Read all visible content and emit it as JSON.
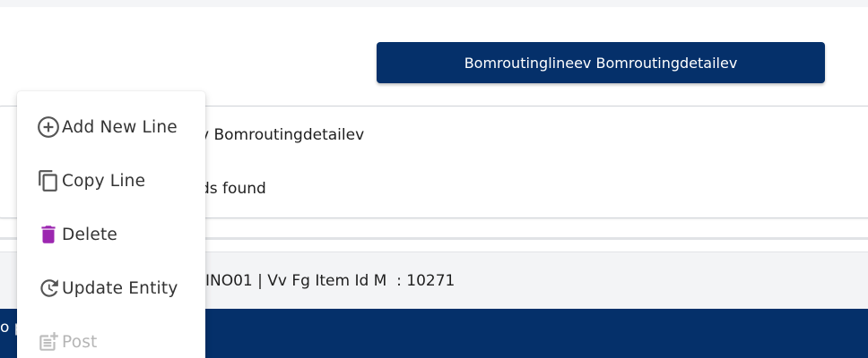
{
  "header": {
    "primary_button_label": "Bomroutinglineev Bomroutingdetailev"
  },
  "card": {
    "title_partial": "v Bomroutingdetailev",
    "empty_partial": "ds found"
  },
  "info_bar": {
    "text_partial": "INO01 | Vv Fg Item Id M  : 10271"
  },
  "footer": {
    "text_partial": "o p"
  },
  "context_menu": {
    "items": [
      {
        "label": "Add New Line",
        "icon": "add-circle-icon",
        "enabled": true
      },
      {
        "label": "Copy Line",
        "icon": "copy-icon",
        "enabled": true
      },
      {
        "label": "Delete",
        "icon": "trash-icon",
        "enabled": true
      },
      {
        "label": "Update Entity",
        "icon": "refresh-clock-icon",
        "enabled": true
      },
      {
        "label": "Post",
        "icon": "post-add-icon",
        "enabled": false
      }
    ]
  },
  "colors": {
    "primary": "#05306a",
    "delete_icon": "#9c27b0",
    "menu_text": "#333333",
    "disabled_text": "#b5b5b5"
  }
}
